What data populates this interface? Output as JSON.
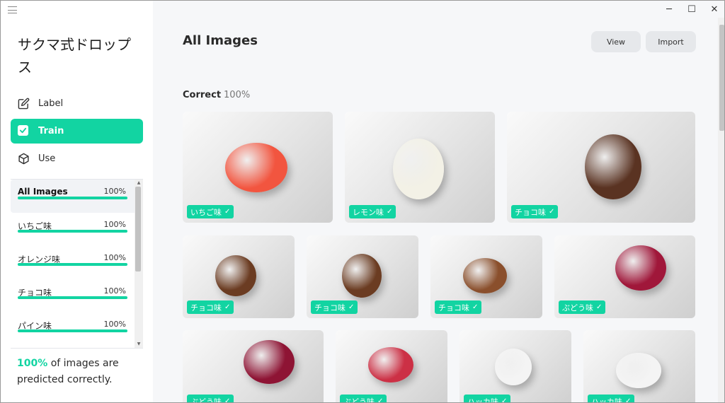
{
  "app": {
    "title": "サクマ式ドロップス"
  },
  "nav": [
    {
      "label": "Label",
      "icon": "edit-icon"
    },
    {
      "label": "Train",
      "icon": "checkbox-icon",
      "active": true
    },
    {
      "label": "Use",
      "icon": "cube-icon"
    }
  ],
  "classes": [
    {
      "name": "All Images",
      "pct": "100%",
      "selected": true
    },
    {
      "name": "いちご味",
      "pct": "100%"
    },
    {
      "name": "オレンジ味",
      "pct": "100%"
    },
    {
      "name": "チョコ味",
      "pct": "100%"
    },
    {
      "name": "パイン味",
      "pct": "100%"
    }
  ],
  "summary": {
    "accent": "100%",
    "text": " of images are predicted correctly."
  },
  "main": {
    "title": "All Images",
    "view_label": "View",
    "import_label": "Import",
    "section": {
      "label": "Correct",
      "pct": "100%"
    }
  },
  "images": [
    {
      "label": "いちご味",
      "candy_color": "#f2553f"
    },
    {
      "label": "レモン味",
      "candy_color": "#f3f1e6"
    },
    {
      "label": "チョコ味",
      "candy_color": "#5a3322"
    },
    {
      "label": "チョコ味",
      "candy_color": "#6b3c22"
    },
    {
      "label": "チョコ味",
      "candy_color": "#6b3c22"
    },
    {
      "label": "チョコ味",
      "candy_color": "#8a4f2c"
    },
    {
      "label": "ぶどう味",
      "candy_color": "#a0173a"
    },
    {
      "label": "ぶどう味",
      "candy_color": "#8e1434"
    },
    {
      "label": "ぶどう味",
      "candy_color": "#cc3045"
    },
    {
      "label": "ハッカ味",
      "candy_color": "#f4f4f4"
    },
    {
      "label": "ハッカ味",
      "candy_color": "#f4f4f4"
    }
  ],
  "colors": {
    "accent": "#12d4a2",
    "sidebar_bg": "#ffffff",
    "main_bg": "#f6f7f9"
  }
}
